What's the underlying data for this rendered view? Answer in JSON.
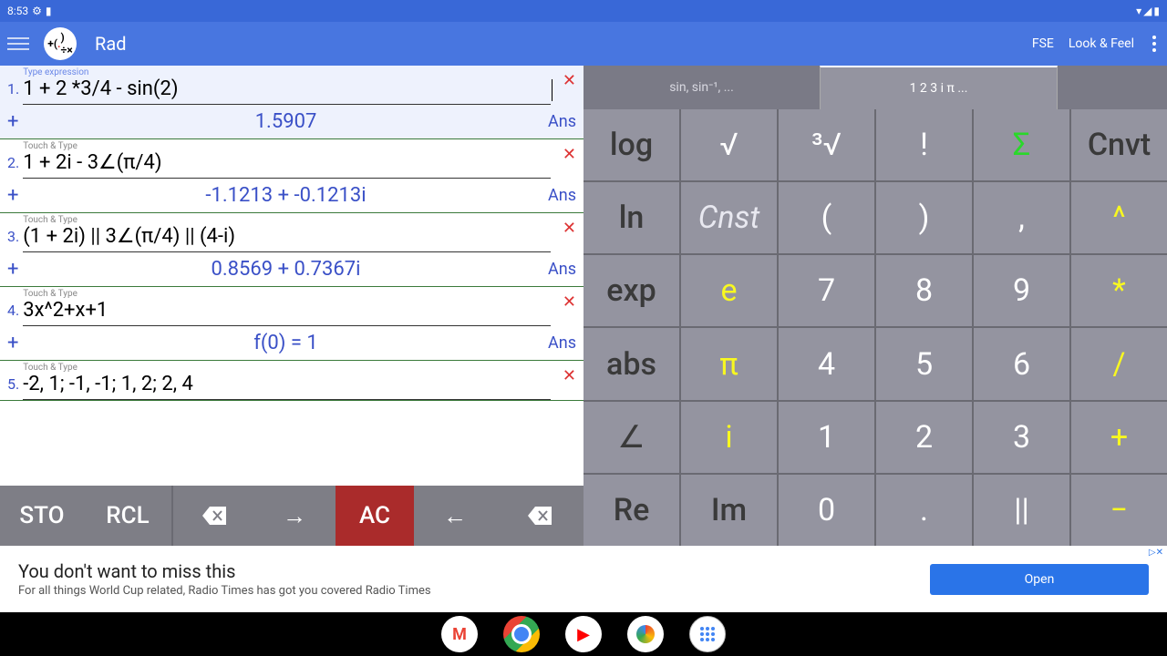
{
  "status": {
    "time": "8:53",
    "icons": [
      "gear-icon",
      "sd-icon"
    ]
  },
  "appbar": {
    "title": "Rad",
    "fse": "FSE",
    "look": "Look & Feel"
  },
  "history": [
    {
      "num": "1.",
      "hint": "Type expression",
      "expr": "1 + 2 *3/4 - sin(2)",
      "result": "1.5907",
      "ans": "Ans",
      "active": true
    },
    {
      "num": "2.",
      "hint": "Touch & Type",
      "expr": "1 + 2i - 3∠(π/4)",
      "result": "-1.1213 + -0.1213i",
      "ans": "Ans",
      "active": false
    },
    {
      "num": "3.",
      "hint": "Touch & Type",
      "expr": "(1 + 2i) || 3∠(π/4) || (4-i)",
      "result": "0.8569 + 0.7367i",
      "ans": "Ans",
      "active": false
    },
    {
      "num": "4.",
      "hint": "Touch & Type",
      "expr": "3x^2+x+1",
      "result": "f(0) = 1",
      "ans": "Ans",
      "active": false
    },
    {
      "num": "5.",
      "hint": "Touch & Type",
      "expr": "-2, 1;  -1, -1;  1, 2;  2, 4",
      "result": "",
      "ans": "",
      "active": false
    }
  ],
  "ctrl": {
    "sto": "STO",
    "rcl": "RCL",
    "ac": "AC"
  },
  "tabs": {
    "trig": "sin, sin⁻¹, ...",
    "num": "1 2 3 i π ..."
  },
  "keys": [
    [
      {
        "t": "log",
        "c": "dark"
      },
      {
        "t": "√",
        "c": ""
      },
      {
        "t": "³√",
        "c": ""
      },
      {
        "t": "!",
        "c": ""
      },
      {
        "t": "Σ",
        "c": "green"
      },
      {
        "t": "Cnvt",
        "c": "dark"
      }
    ],
    [
      {
        "t": "ln",
        "c": "dark"
      },
      {
        "t": "Cnst",
        "c": "italic"
      },
      {
        "t": "(",
        "c": ""
      },
      {
        "t": ")",
        "c": ""
      },
      {
        "t": ",",
        "c": ""
      },
      {
        "t": "^",
        "c": "yellow"
      }
    ],
    [
      {
        "t": "exp",
        "c": "dark"
      },
      {
        "t": "e",
        "c": "yellow"
      },
      {
        "t": "7",
        "c": ""
      },
      {
        "t": "8",
        "c": ""
      },
      {
        "t": "9",
        "c": ""
      },
      {
        "t": "*",
        "c": "yellow"
      }
    ],
    [
      {
        "t": "abs",
        "c": "dark"
      },
      {
        "t": "π",
        "c": "yellow"
      },
      {
        "t": "4",
        "c": ""
      },
      {
        "t": "5",
        "c": ""
      },
      {
        "t": "6",
        "c": ""
      },
      {
        "t": "/",
        "c": "yellow"
      }
    ],
    [
      {
        "t": "∠",
        "c": "dark"
      },
      {
        "t": "i",
        "c": "yellow"
      },
      {
        "t": "1",
        "c": ""
      },
      {
        "t": "2",
        "c": ""
      },
      {
        "t": "3",
        "c": ""
      },
      {
        "t": "+",
        "c": "yellow"
      }
    ],
    [
      {
        "t": "Re",
        "c": "dark"
      },
      {
        "t": "Im",
        "c": "dark"
      },
      {
        "t": "0",
        "c": ""
      },
      {
        "t": ".",
        "c": ""
      },
      {
        "t": "||",
        "c": ""
      },
      {
        "t": "−",
        "c": "yellow"
      }
    ]
  ],
  "ad": {
    "title": "You don't want to miss this",
    "sub": "For all things World Cup related, Radio Times has got you covered Radio Times",
    "btn": "Open",
    "mark": "▷✕"
  }
}
